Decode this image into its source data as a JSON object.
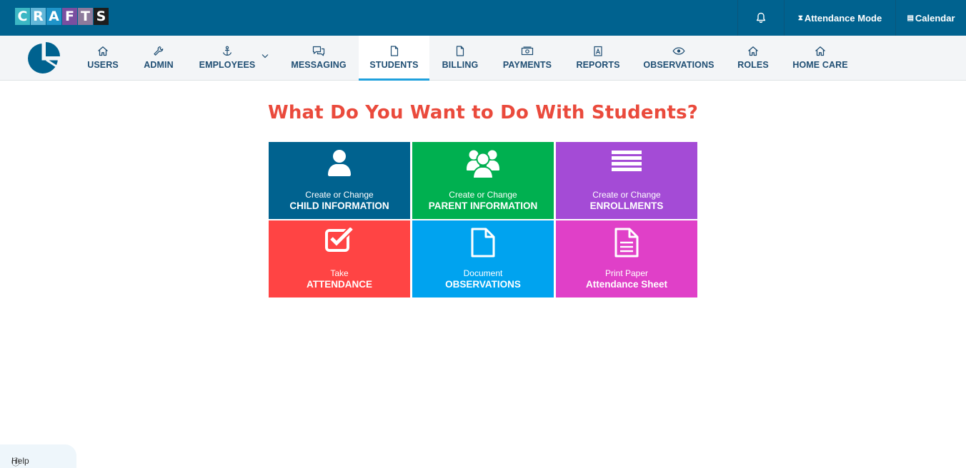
{
  "brand": {
    "letters": [
      "C",
      "R",
      "A",
      "F",
      "T",
      "S"
    ],
    "letter_colors": [
      "#3cb7c4",
      "#62b6d8",
      "#1f94c9",
      "#7a4fa0",
      "#8c7a9c",
      "#1d1d1d"
    ]
  },
  "topbar": {
    "bell_icon": "bell-icon",
    "attendance_mode": "Attendance Mode",
    "calendar": "Calendar"
  },
  "nav": {
    "items": [
      {
        "label": "USERS",
        "icon": "home-icon"
      },
      {
        "label": "ADMIN",
        "icon": "wrench-icon"
      },
      {
        "label": "EMPLOYEES",
        "icon": "anchor-icon"
      },
      {
        "label": "MESSAGING",
        "icon": "messages-icon"
      },
      {
        "label": "STUDENTS",
        "icon": "file-icon",
        "active": true
      },
      {
        "label": "BILLING",
        "icon": "file-icon"
      },
      {
        "label": "PAYMENTS",
        "icon": "money-icon"
      },
      {
        "label": "REPORTS",
        "icon": "report-icon"
      },
      {
        "label": "OBSERVATIONS",
        "icon": "eye-icon"
      },
      {
        "label": "ROLES",
        "icon": "home-icon"
      },
      {
        "label": "HOME CARE",
        "icon": "home-icon"
      }
    ]
  },
  "main": {
    "headline": "What Do You Want to Do With Students?",
    "tiles": [
      {
        "sub": "Create or Change",
        "main": "CHILD INFORMATION",
        "color": "#00628f",
        "icon": "user-icon"
      },
      {
        "sub": "Create or Change",
        "main": "PARENT INFORMATION",
        "color": "#00b050",
        "icon": "users-group-icon"
      },
      {
        "sub": "Create or Change",
        "main": "ENROLLMENTS",
        "color": "#a44bd6",
        "icon": "list-icon"
      },
      {
        "sub": "Take",
        "main": "ATTENDANCE",
        "color": "#ff4444",
        "icon": "checkbox-icon"
      },
      {
        "sub": "Document",
        "main": "OBSERVATIONS",
        "color": "#00a3ef",
        "icon": "document-icon"
      },
      {
        "sub": "Print Paper",
        "main": "Attendance Sheet",
        "color": "#e040c8",
        "icon": "document-lines-icon"
      }
    ]
  },
  "footer": {
    "help": "Help"
  }
}
